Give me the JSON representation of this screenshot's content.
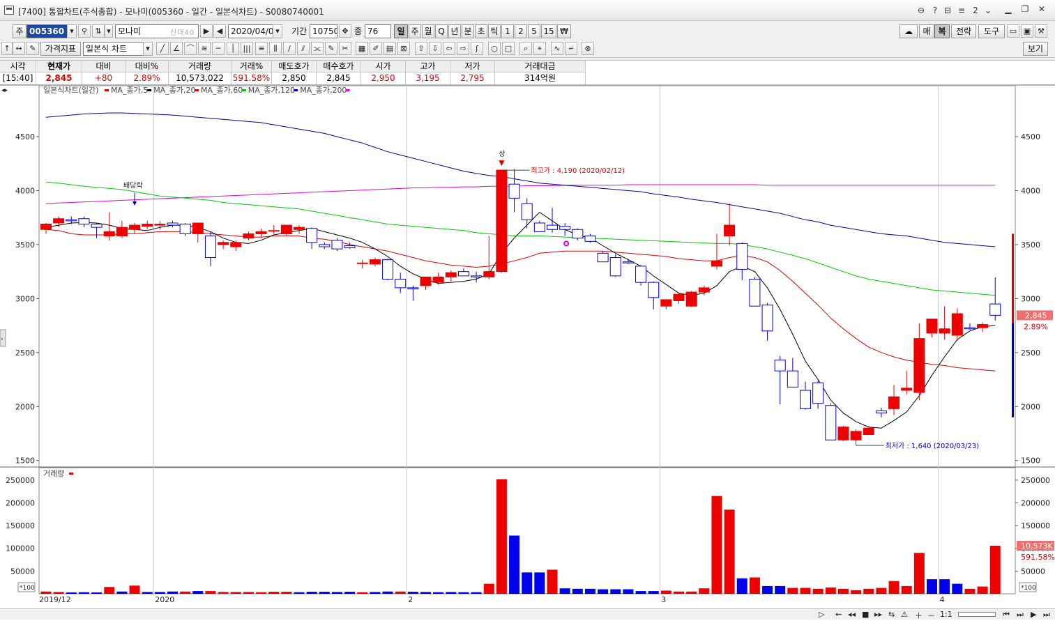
{
  "window": {
    "title": "[7400] 통합차트(주식종합) - 모나미(005360 - 일간 - 일본식차트) - S0080740001",
    "title_icons": [
      "?",
      "?",
      "2"
    ],
    "controls": [
      "minimize",
      "restore",
      "close"
    ]
  },
  "toolbar1": {
    "market_label": "주",
    "code": "005360",
    "name": "모나미",
    "tags": [
      "신",
      "대",
      "40"
    ],
    "date": "2020/04/07",
    "period_label": "기간",
    "period_value": "10750",
    "count_label": "종",
    "count_value": "76",
    "intervals": [
      "일",
      "주",
      "월",
      "Q",
      "년",
      "분",
      "초",
      "틱",
      "1",
      "2",
      "5",
      "15",
      "₩"
    ],
    "selected_interval": "일",
    "right_buttons": [
      "매",
      "복",
      "전략",
      "도구",
      "보기"
    ],
    "strategy_label": "전략",
    "tools_label": "도구"
  },
  "toolbar2": {
    "indicator_button": "가격지표",
    "chart_type": "일본식 차트",
    "view_button": "보기"
  },
  "quote": {
    "headers": [
      "시각",
      "현재가",
      "대비",
      "대비%",
      "거래량",
      "거래%",
      "매도호가",
      "매수호가",
      "시가",
      "고가",
      "저가",
      "거래대금"
    ],
    "values": [
      "[15:40]",
      "2,845",
      "+80",
      "2.89%",
      "10,573,022",
      "591.58%",
      "2,850",
      "2,845",
      "2,950",
      "3,195",
      "2,795",
      "314억원"
    ],
    "value_colors": [
      "#000000",
      "#e00000",
      "#e00000",
      "#e00000",
      "#000000",
      "#e00000",
      "#000000",
      "#000000",
      "#e00000",
      "#e00000",
      "#e00000",
      "#000000"
    ]
  },
  "legend": {
    "title": "일본식차트(일간)",
    "items": [
      {
        "label": "MA_종가,5",
        "color": "#e00000"
      },
      {
        "label": "MA_종가,20",
        "color": "#000000"
      },
      {
        "label": "MA_종가,60",
        "color": "#e00000"
      },
      {
        "label": "MA_종가,120",
        "color": "#00c000"
      },
      {
        "label": "MA_종가,200",
        "color": "#0000c0"
      },
      {
        "label": "",
        "color": "#e000e0"
      }
    ],
    "volume_title": "거래량"
  },
  "annotations": {
    "high": "최고가 : 4,190 (2020/02/12)",
    "low": "최저가 : 1,640 (2020/03/23)",
    "dividend": "배당락",
    "upper_limit": "상",
    "current_price": "2,845",
    "current_change": "2.89%",
    "current_volume": "10,573K",
    "volume_pct": "591.58%",
    "scale_badge": "*100"
  },
  "colors": {
    "up": "#ee0000",
    "down": "#0000ee",
    "ma5": "#000000",
    "ma20": "#dd0000",
    "ma60": "#00cc00",
    "ma120": "#0000aa",
    "ma200": "#dd00dd"
  },
  "chart_data": [
    {
      "type": "candlestick",
      "title": "일본식차트(일간)",
      "y_ticks": [
        1500,
        2000,
        2500,
        3000,
        3500,
        4000,
        4500
      ],
      "ylim": [
        1440,
        4920
      ],
      "x_labels": [
        "2019/12",
        "2020",
        "2",
        "3",
        "4"
      ],
      "candles": [
        [
          3640,
          3700,
          3600,
          3690
        ],
        [
          3700,
          3760,
          3660,
          3740
        ],
        [
          3730,
          3760,
          3690,
          3720
        ],
        [
          3740,
          3760,
          3660,
          3690
        ],
        [
          3690,
          3700,
          3560,
          3660
        ],
        [
          3580,
          3800,
          3540,
          3620
        ],
        [
          3580,
          3720,
          3560,
          3660
        ],
        [
          3640,
          3700,
          3600,
          3680
        ],
        [
          3670,
          3720,
          3640,
          3690
        ],
        [
          3680,
          3720,
          3640,
          3690
        ],
        [
          3700,
          3720,
          3660,
          3680
        ],
        [
          3690,
          3700,
          3580,
          3600
        ],
        [
          3600,
          3680,
          3520,
          3700
        ],
        [
          3580,
          3620,
          3300,
          3380
        ],
        [
          3500,
          3540,
          3460,
          3520
        ],
        [
          3480,
          3540,
          3440,
          3520
        ],
        [
          3560,
          3620,
          3540,
          3600
        ],
        [
          3600,
          3650,
          3560,
          3620
        ],
        [
          3630,
          3680,
          3600,
          3630
        ],
        [
          3600,
          3680,
          3580,
          3680
        ],
        [
          3640,
          3680,
          3600,
          3660
        ],
        [
          3650,
          3660,
          3460,
          3520
        ],
        [
          3500,
          3520,
          3460,
          3480
        ],
        [
          3540,
          3560,
          3440,
          3460
        ],
        [
          3490,
          3520,
          3460,
          3470
        ],
        [
          3330,
          3360,
          3280,
          3330
        ],
        [
          3320,
          3380,
          3300,
          3360
        ],
        [
          3360,
          3370,
          3170,
          3180
        ],
        [
          3180,
          3240,
          3050,
          3100
        ],
        [
          3100,
          3120,
          2980,
          3090
        ],
        [
          3120,
          3200,
          3080,
          3200
        ],
        [
          3150,
          3240,
          3130,
          3200
        ],
        [
          3200,
          3260,
          3160,
          3240
        ],
        [
          3250,
          3280,
          3210,
          3210
        ],
        [
          3210,
          3250,
          3150,
          3200
        ],
        [
          3200,
          3580,
          3180,
          3250
        ],
        [
          3250,
          4190,
          3240,
          4190
        ],
        [
          4060,
          4200,
          3800,
          3930
        ],
        [
          3880,
          3930,
          3650,
          3730
        ],
        [
          3700,
          3720,
          3620,
          3620
        ],
        [
          3680,
          3840,
          3610,
          3640
        ],
        [
          3670,
          3700,
          3580,
          3640
        ],
        [
          3640,
          3650,
          3540,
          3560
        ],
        [
          3580,
          3600,
          3520,
          3530
        ],
        [
          3420,
          3440,
          3340,
          3340
        ],
        [
          3380,
          3410,
          3200,
          3210
        ],
        [
          3340,
          3370,
          3320,
          3330
        ],
        [
          3300,
          3310,
          3120,
          3150
        ],
        [
          3150,
          3160,
          2900,
          3010
        ],
        [
          2930,
          2980,
          2900,
          2990
        ],
        [
          2980,
          3050,
          2950,
          3040
        ],
        [
          2930,
          3070,
          2920,
          3060
        ],
        [
          3060,
          3120,
          3030,
          3100
        ],
        [
          3300,
          3600,
          3270,
          3350
        ],
        [
          3580,
          3880,
          3490,
          3680
        ],
        [
          3510,
          3520,
          3170,
          3270
        ],
        [
          3180,
          3200,
          2940,
          2930
        ],
        [
          2940,
          2960,
          2610,
          2700
        ],
        [
          2430,
          2470,
          2020,
          2330
        ],
        [
          2330,
          2450,
          2230,
          2180
        ],
        [
          2150,
          2230,
          1970,
          1980
        ],
        [
          2220,
          2240,
          1980,
          2030
        ],
        [
          2010,
          2030,
          1690,
          1690
        ],
        [
          1690,
          1820,
          1680,
          1810
        ],
        [
          1690,
          1790,
          1640,
          1770
        ],
        [
          1740,
          1820,
          1780,
          1800
        ],
        [
          1960,
          1990,
          1900,
          1940
        ],
        [
          1980,
          2200,
          1920,
          2090
        ],
        [
          2150,
          2330,
          2110,
          2170
        ],
        [
          2130,
          2770,
          2060,
          2630
        ],
        [
          2680,
          2790,
          2640,
          2810
        ],
        [
          2680,
          2930,
          2620,
          2720
        ],
        [
          2660,
          2910,
          2610,
          2860
        ],
        [
          2730,
          2770,
          2710,
          2720
        ],
        [
          2730,
          2780,
          2690,
          2760
        ],
        [
          2950,
          3195,
          2795,
          2845
        ]
      ],
      "ma5": [
        3660,
        3680,
        3700,
        3705,
        3700,
        3680,
        3650,
        3640,
        3630,
        3660,
        3680,
        3680,
        3660,
        3620,
        3560,
        3520,
        3510,
        3540,
        3590,
        3610,
        3630,
        3650,
        3620,
        3590,
        3560,
        3520,
        3460,
        3390,
        3300,
        3230,
        3180,
        3140,
        3150,
        3160,
        3180,
        3230,
        3420,
        3560,
        3680,
        3800,
        3720,
        3640,
        3590,
        3560,
        3490,
        3420,
        3360,
        3300,
        3210,
        3130,
        3050,
        3030,
        3050,
        3120,
        3250,
        3300,
        3250,
        3100,
        2900,
        2670,
        2420,
        2250,
        2060,
        1940,
        1860,
        1810,
        1800,
        1870,
        1950,
        2100,
        2290,
        2460,
        2620,
        2700,
        2740,
        2750
      ],
      "ma20": [
        3640,
        3630,
        3600,
        3590,
        3590,
        3590,
        3600,
        3600,
        3610,
        3620,
        3620,
        3620,
        3610,
        3600,
        3590,
        3580,
        3570,
        3570,
        3580,
        3580,
        3580,
        3560,
        3550,
        3530,
        3500,
        3480,
        3460,
        3440,
        3410,
        3380,
        3350,
        3330,
        3310,
        3300,
        3290,
        3300,
        3320,
        3350,
        3380,
        3420,
        3430,
        3440,
        3440,
        3440,
        3440,
        3430,
        3420,
        3410,
        3400,
        3390,
        3370,
        3360,
        3350,
        3350,
        3380,
        3400,
        3380,
        3340,
        3260,
        3160,
        3050,
        2940,
        2820,
        2720,
        2630,
        2550,
        2500,
        2460,
        2430,
        2410,
        2390,
        2380,
        2360,
        2350,
        2340,
        2330
      ],
      "ma60": [
        4080,
        4070,
        4055,
        4040,
        4030,
        4020,
        4010,
        3990,
        3970,
        3950,
        3940,
        3930,
        3920,
        3910,
        3890,
        3880,
        3870,
        3860,
        3850,
        3840,
        3830,
        3810,
        3790,
        3770,
        3750,
        3730,
        3710,
        3690,
        3680,
        3670,
        3660,
        3650,
        3640,
        3630,
        3610,
        3600,
        3590,
        3580,
        3580,
        3580,
        3575,
        3570,
        3565,
        3560,
        3555,
        3550,
        3545,
        3540,
        3535,
        3530,
        3525,
        3520,
        3515,
        3510,
        3510,
        3500,
        3480,
        3460,
        3430,
        3400,
        3370,
        3330,
        3290,
        3250,
        3210,
        3180,
        3160,
        3140,
        3120,
        3100,
        3080,
        3070,
        3060,
        3050,
        3040,
        3030
      ],
      "ma120": [
        4680,
        4690,
        4700,
        4710,
        4715,
        4720,
        4720,
        4715,
        4710,
        4705,
        4700,
        4690,
        4680,
        4670,
        4660,
        4650,
        4640,
        4630,
        4610,
        4590,
        4570,
        4550,
        4530,
        4500,
        4470,
        4440,
        4400,
        4360,
        4330,
        4300,
        4270,
        4240,
        4210,
        4180,
        4160,
        4140,
        4130,
        4110,
        4090,
        4070,
        4060,
        4050,
        4040,
        4030,
        4020,
        4010,
        4000,
        3990,
        3970,
        3955,
        3940,
        3920,
        3905,
        3890,
        3870,
        3850,
        3830,
        3810,
        3790,
        3760,
        3730,
        3710,
        3680,
        3660,
        3640,
        3620,
        3600,
        3590,
        3580,
        3560,
        3540,
        3520,
        3510,
        3500,
        3490,
        3480
      ],
      "ma200": [
        3880,
        3885,
        3890,
        3895,
        3900,
        3905,
        3910,
        3915,
        3920,
        3925,
        3930,
        3935,
        3940,
        3945,
        3950,
        3955,
        3960,
        3965,
        3970,
        3975,
        3980,
        3985,
        3990,
        3995,
        4000,
        4005,
        4010,
        4015,
        4020,
        4025,
        4025,
        4030,
        4030,
        4035,
        4035,
        4040,
        4040,
        4040,
        4045,
        4045,
        4045,
        4050,
        4050,
        4050,
        4050,
        4050,
        4055,
        4055,
        4055,
        4055,
        4055,
        4055,
        4055,
        4055,
        4055,
        4055,
        4055,
        4050,
        4050,
        4050,
        4050,
        4050,
        4050,
        4050,
        4050,
        4050,
        4050,
        4050,
        4050,
        4050,
        4050,
        4050,
        4050,
        4050,
        4050,
        4050
      ]
    },
    {
      "type": "bar",
      "title": "거래량",
      "y_ticks": [
        0,
        50000,
        100000,
        150000,
        200000,
        250000
      ],
      "ylim": [
        0,
        262000
      ],
      "values": [
        5000,
        4000,
        3000,
        3500,
        3000,
        15000,
        5000,
        18000,
        4000,
        4000,
        5000,
        5000,
        6000,
        6000,
        4000,
        4000,
        4000,
        3500,
        4500,
        4500,
        3500,
        4500,
        4500,
        4000,
        4500,
        3500,
        4000,
        5000,
        5000,
        4500,
        4000,
        3500,
        4000,
        3500,
        3500,
        22000,
        252000,
        128000,
        47000,
        47000,
        53000,
        12000,
        11000,
        11000,
        10000,
        10000,
        10000,
        6000,
        6000,
        7000,
        5000,
        5000,
        12000,
        215000,
        185000,
        34000,
        36000,
        17000,
        17000,
        13000,
        13000,
        11000,
        14000,
        11000,
        8000,
        11000,
        13000,
        28000,
        17000,
        90000,
        32000,
        32000,
        22000,
        11000,
        16000,
        105730
      ],
      "up": [
        true,
        true,
        false,
        false,
        false,
        true,
        false,
        true,
        false,
        false,
        false,
        true,
        false,
        true,
        true,
        true,
        true,
        true,
        true,
        true,
        false,
        false,
        false,
        false,
        false,
        true,
        false,
        false,
        true,
        false,
        false,
        false,
        false,
        false,
        false,
        true,
        true,
        false,
        false,
        false,
        true,
        false,
        false,
        false,
        false,
        false,
        false,
        false,
        false,
        true,
        true,
        true,
        true,
        true,
        true,
        false,
        true,
        false,
        false,
        true,
        true,
        true,
        true,
        true,
        true,
        true,
        true,
        true,
        true,
        true,
        false,
        false,
        false,
        true,
        true,
        true
      ]
    }
  ]
}
